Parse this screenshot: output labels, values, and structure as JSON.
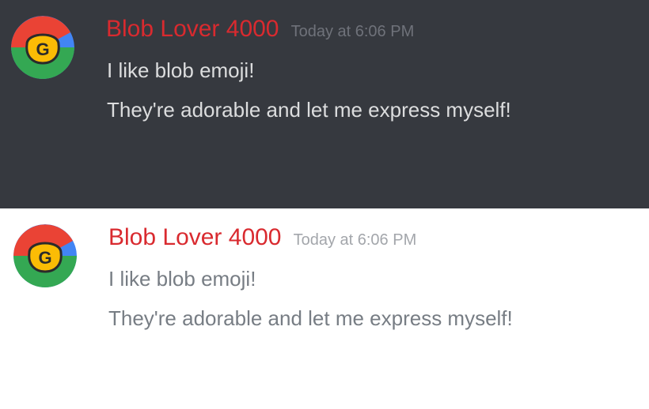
{
  "messages": [
    {
      "theme": "dark",
      "author": "Blob Lover 4000",
      "timestamp": "Today at 6:06 PM",
      "avatar_icon": "google-g-blob-avatar",
      "lines": [
        "I like blob emoji!",
        "They're adorable and let me express myself!"
      ]
    },
    {
      "theme": "light",
      "author": "Blob Lover 4000",
      "timestamp": "Today at 6:06 PM",
      "avatar_icon": "google-g-blob-avatar",
      "lines": [
        "I like blob emoji!",
        "They're adorable and let me express myself!"
      ]
    }
  ],
  "colors": {
    "dark_background": "#36393f",
    "light_background": "#ffffff",
    "username": "#d92a2f",
    "google_red": "#ea4335",
    "google_blue": "#4285f4",
    "google_green": "#34a853",
    "google_yellow": "#fbbc05"
  }
}
